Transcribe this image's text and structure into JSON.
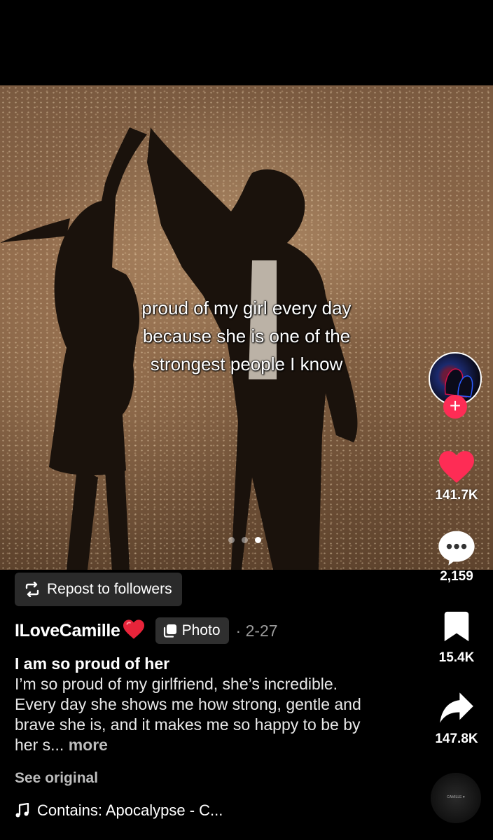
{
  "post": {
    "caption_lines": [
      "proud of my girl every day",
      "because she is one of the",
      "strongest people I know"
    ],
    "carousel": {
      "count": 3,
      "active_index": 2
    }
  },
  "rail": {
    "likes": "141.7K",
    "comments": "2,159",
    "saves": "15.4K",
    "shares": "147.8K",
    "follow_symbol": "+",
    "disc_label": "CAMILLE ♥"
  },
  "repost": {
    "label": "Repost to followers"
  },
  "author": {
    "username": "ILoveCamille",
    "emoji": "❤️"
  },
  "badge": {
    "label": "Photo"
  },
  "date": "· 2-27",
  "title": "I am so proud of her",
  "description": "I’m so proud of my girlfriend, she’s incredible. Every day she shows me how strong, gentle and brave she is, and it makes me so happy to be by her s...",
  "more_label": "more",
  "see_original": "See original",
  "music": {
    "label": "Contains: Apocalypse - C..."
  },
  "colors": {
    "accent": "#fe2c55",
    "background": "#000000"
  },
  "icons": [
    "repost-icon",
    "photo-icon",
    "heart-icon",
    "comment-icon",
    "bookmark-icon",
    "share-icon",
    "music-note-icon",
    "plus-icon"
  ]
}
